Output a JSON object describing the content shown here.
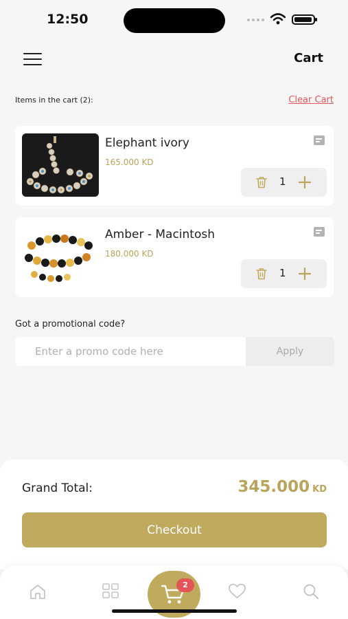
{
  "status_bar": {
    "time": "12:50"
  },
  "header": {
    "title": "Cart",
    "menu_icon": "hamburger-menu-icon"
  },
  "cart": {
    "items_count_label": "Items in the cart (2):",
    "clear_label": "Clear Cart",
    "items": [
      {
        "name": "Elephant ivory",
        "price": "165.000 KD",
        "quantity": "1"
      },
      {
        "name": "Amber - Macintosh",
        "price": "180.000 KD",
        "quantity": "1"
      }
    ]
  },
  "promo": {
    "label": "Got a promotional code?",
    "placeholder": "Enter a promo code here",
    "apply_label": "Apply"
  },
  "totals": {
    "label": "Grand Total:",
    "amount": "345.000",
    "currency": "KD",
    "checkout_label": "Checkout"
  },
  "bottom_nav": {
    "items": [
      "home-icon",
      "grid-icon",
      "cart-icon",
      "heart-icon",
      "search-icon"
    ],
    "cart_badge": "2",
    "active": "cart-icon"
  },
  "colors": {
    "accent": "#c0aa5e",
    "price": "#b8a55a",
    "danger": "#e0555b",
    "background": "#f6f6f6"
  }
}
